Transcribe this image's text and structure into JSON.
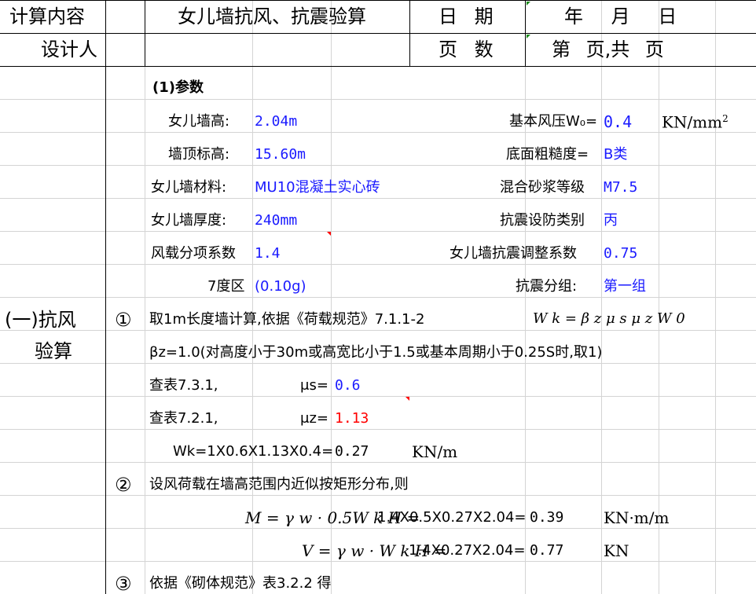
{
  "header": {
    "row1": {
      "label": "计算内容",
      "title": "女儿墙抗风、抗震验算",
      "date_label": "日 期",
      "date_value": "年 月 日"
    },
    "row2": {
      "label": "设计人",
      "pages_label": "页 数",
      "pages_value": "第 页,共 页"
    }
  },
  "section_label_line1": "(一)抗风",
  "section_label_line2": "验算",
  "params": {
    "heading": "(1)参数",
    "height_label": "女儿墙高:",
    "height_value": "2.04m",
    "top_elev_label": "墙顶标高:",
    "top_elev_value": "15.60m",
    "material_label": "女儿墙材料:",
    "material_value": "MU10混凝土实心砖",
    "thickness_label": "女儿墙厚度:",
    "thickness_value": "240mm",
    "wind_factor_label": "风载分项系数",
    "wind_factor_value": "1.4",
    "intensity_label": "7度区",
    "intensity_value": "(0.10g)",
    "wind_pressure_label": "基本风压W₀=",
    "wind_pressure_value": "0.4",
    "wind_pressure_unit": "KN/mm",
    "wind_pressure_unit_sup": "2",
    "roughness_label": "底面粗糙度=",
    "roughness_value": "B类",
    "mortar_label": "混合砂浆等级",
    "mortar_value": "M7.5",
    "seismic_cat_label": "抗震设防类别",
    "seismic_cat_value": "丙",
    "seismic_adj_label": "女儿墙抗震调整系数",
    "seismic_adj_value": "0.75",
    "seismic_group_label": "抗震分组:",
    "seismic_group_value": "第一组"
  },
  "steps": {
    "s1_num": "①",
    "s1_text": "取1m长度墙计算,依据《荷载规范》7.1.1-2",
    "s1_formula": "W k = β z μ s μ z W 0",
    "beta_text": "βz=1.0(对高度小于30m或高宽比小于1.5或基本周期小于0.25S时,取1)",
    "mus_ref": "查表7.3.1,",
    "mus_label": "μs=",
    "mus_value": "0.6",
    "muz_ref": "查表7.2.1,",
    "muz_label": "μz=",
    "muz_value": "1.13",
    "wk_expr": "Wk=1X0.6X1.13X0.4=",
    "wk_value": "0.27",
    "wk_unit": "KN/m",
    "s2_num": "②",
    "s2_text": "设风荷载在墙高范围内近似按矩形分布,则",
    "m_formula": "M = γ w · 0.5W k H =",
    "m_expr": "1.4X0.5X0.27X2.04=",
    "m_value": "0.39",
    "m_unit": "KN·m/m",
    "v_formula": "V = γ w · W k H =",
    "v_expr": "1.4X0.27X2.04=",
    "v_value": "0.77",
    "v_unit": "KN",
    "s3_num": "③",
    "s3_text": "依据《砌体规范》表3.2.2 得"
  }
}
